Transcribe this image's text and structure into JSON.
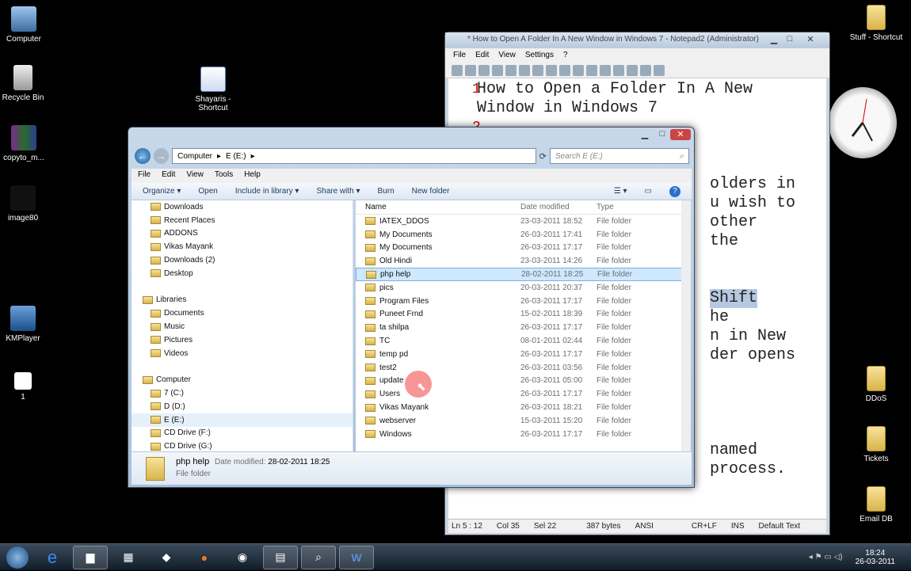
{
  "desktop": {
    "icons_left": [
      {
        "label": "Computer"
      },
      {
        "label": "Recycle Bin"
      },
      {
        "label": "copyto_m..."
      },
      {
        "label": "image80"
      },
      {
        "label": "KMPlayer"
      },
      {
        "label": "1"
      }
    ],
    "shortcut_shayaris": "Shayaris - Shortcut",
    "icons_right": [
      {
        "label": "Stuff - Shortcut"
      },
      {
        "label": "DDoS"
      },
      {
        "label": "Tickets"
      },
      {
        "label": "Email DB"
      }
    ]
  },
  "notepad": {
    "title": "* How to Open A Folder In A New Window in Windows 7 - Notepad2 (Administrator)",
    "menu": [
      "File",
      "Edit",
      "View",
      "Settings",
      "?"
    ],
    "lines": [
      {
        "num": "1",
        "text": "How to Open a Folder In A New"
      },
      {
        "num": "",
        "text": "Window in Windows 7"
      },
      {
        "num": "2",
        "text": ""
      }
    ],
    "visible_fragments": [
      "olders in",
      "u wish to",
      "other",
      "the",
      "Shift",
      "he",
      "n in New",
      "der opens",
      "named",
      "process."
    ],
    "status": [
      "Ln 5 : 12",
      "Col 35",
      "Sel 22",
      "387 bytes",
      "ANSI",
      "CR+LF",
      "INS",
      "Default Text"
    ]
  },
  "explorer": {
    "breadcrumb": [
      "Computer",
      "E (E:)"
    ],
    "search_placeholder": "Search E (E:)",
    "menu": [
      "File",
      "Edit",
      "View",
      "Tools",
      "Help"
    ],
    "commands": [
      "Organize ▾",
      "Open",
      "Include in library ▾",
      "Share with ▾",
      "Burn",
      "New folder"
    ],
    "nav": [
      {
        "label": "Downloads",
        "level": 1
      },
      {
        "label": "Recent Places",
        "level": 1
      },
      {
        "label": "ADDONS",
        "level": 1
      },
      {
        "label": "Vikas Mayank",
        "level": 1
      },
      {
        "label": "Downloads (2)",
        "level": 1
      },
      {
        "label": "Desktop",
        "level": 1
      },
      {
        "label": "",
        "level": 0
      },
      {
        "label": "Libraries",
        "level": 0
      },
      {
        "label": "Documents",
        "level": 1
      },
      {
        "label": "Music",
        "level": 1
      },
      {
        "label": "Pictures",
        "level": 1
      },
      {
        "label": "Videos",
        "level": 1
      },
      {
        "label": "",
        "level": 0
      },
      {
        "label": "Computer",
        "level": 0
      },
      {
        "label": "7 (C:)",
        "level": 1
      },
      {
        "label": "D (D:)",
        "level": 1
      },
      {
        "label": "E (E:)",
        "level": 1
      },
      {
        "label": "CD Drive (F:)",
        "level": 1
      },
      {
        "label": "CD Drive (G:)",
        "level": 1
      }
    ],
    "columns": [
      "Name",
      "Date modified",
      "Type"
    ],
    "files": [
      {
        "name": "IATEX_DDOS",
        "date": "23-03-2011 18:52",
        "type": "File folder"
      },
      {
        "name": "My Documents",
        "date": "26-03-2011 17:41",
        "type": "File folder"
      },
      {
        "name": "My Documents",
        "date": "26-03-2011 17:17",
        "type": "File folder"
      },
      {
        "name": "Old Hindi",
        "date": "23-03-2011 14:26",
        "type": "File folder"
      },
      {
        "name": "php help",
        "date": "28-02-2011 18:25",
        "type": "File folder",
        "selected": true
      },
      {
        "name": "pics",
        "date": "20-03-2011 20:37",
        "type": "File folder"
      },
      {
        "name": "Program Files",
        "date": "26-03-2011 17:17",
        "type": "File folder"
      },
      {
        "name": "Puneet Frnd",
        "date": "15-02-2011 18:39",
        "type": "File folder"
      },
      {
        "name": "ta shilpa",
        "date": "26-03-2011 17:17",
        "type": "File folder"
      },
      {
        "name": "TC",
        "date": "08-01-2011 02:44",
        "type": "File folder"
      },
      {
        "name": "temp pd",
        "date": "26-03-2011 17:17",
        "type": "File folder"
      },
      {
        "name": "test2",
        "date": "26-03-2011 03:56",
        "type": "File folder"
      },
      {
        "name": "update",
        "date": "26-03-2011 05:00",
        "type": "File folder"
      },
      {
        "name": "Users",
        "date": "26-03-2011 17:17",
        "type": "File folder"
      },
      {
        "name": "Vikas Mayank",
        "date": "26-03-2011 18:21",
        "type": "File folder"
      },
      {
        "name": "webserver",
        "date": "15-03-2011 15:20",
        "type": "File folder"
      },
      {
        "name": "Windows",
        "date": "26-03-2011 17:17",
        "type": "File folder"
      }
    ],
    "details": {
      "name": "php help",
      "date_label": "Date modified:",
      "date": "28-02-2011 18:25",
      "type": "File folder"
    }
  },
  "taskbar": {
    "time": "18:24",
    "date": "26-03-2011"
  }
}
